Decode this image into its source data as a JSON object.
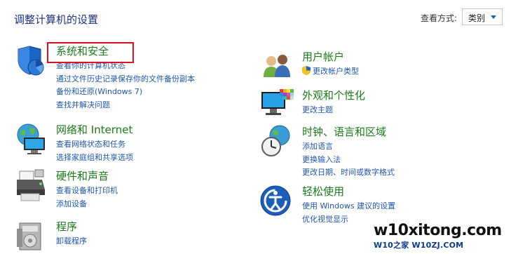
{
  "header": {
    "title": "调整计算机的设置",
    "view_by_label": "查看方式:",
    "view_by_value": "类别"
  },
  "categories": {
    "system_security": {
      "title": "系统和安全",
      "links": [
        "查看你的计算机状态",
        "通过文件历史记录保存你的文件备份副本",
        "备份和还原(Windows 7)",
        "查找并解决问题"
      ]
    },
    "network": {
      "title": "网络和 Internet",
      "links": [
        "查看网络状态和任务",
        "选择家庭组和共享选项"
      ]
    },
    "hardware": {
      "title": "硬件和声音",
      "links": [
        "查看设备和打印机",
        "添加设备"
      ]
    },
    "programs": {
      "title": "程序",
      "links": [
        "卸载程序"
      ]
    },
    "accounts": {
      "title": "用户帐户",
      "links": [
        "更改帐户类型"
      ]
    },
    "appearance": {
      "title": "外观和个性化",
      "links": [
        "更改主题"
      ]
    },
    "clock": {
      "title": "时钟、语言和区域",
      "links": [
        "添加语言",
        "更换输入法",
        "更改日期、时间或数字格式"
      ]
    },
    "ease": {
      "title": "轻松使用",
      "links": [
        "使用 Windows 建议的设置",
        "优化视觉显示"
      ]
    }
  },
  "watermark": {
    "main": "w10xitong.com",
    "sub": "W10之家 W10ZJ.COM"
  },
  "colors": {
    "heading": "#1a7b19",
    "link": "#1f56b0",
    "highlight": "#e0101a",
    "title": "#1e3287"
  }
}
